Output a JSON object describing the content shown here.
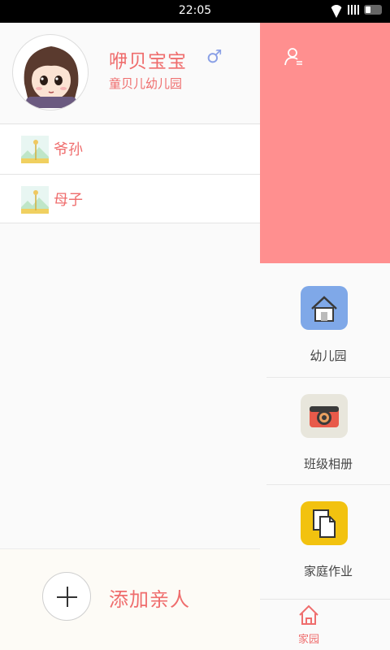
{
  "status_bar": {
    "time": "22:05"
  },
  "profile": {
    "name": "咿贝宝宝",
    "gender_symbol": "♂",
    "school": "童贝儿幼儿园"
  },
  "relatives": [
    {
      "label": "爷孙"
    },
    {
      "label": "母子"
    }
  ],
  "add_relative": {
    "label": "添加亲人"
  },
  "features": [
    {
      "label": "幼儿园",
      "icon": "house-icon",
      "color": "#7fa8e8"
    },
    {
      "label": "班级相册",
      "icon": "camera-icon",
      "color": "#e8e6dc"
    },
    {
      "label": "家庭作业",
      "icon": "documents-icon",
      "color": "#f2c20f"
    }
  ],
  "tab_bar": {
    "active_label": "家园"
  },
  "colors": {
    "accent": "#ef6d6d",
    "banner": "#ff8f8f"
  }
}
